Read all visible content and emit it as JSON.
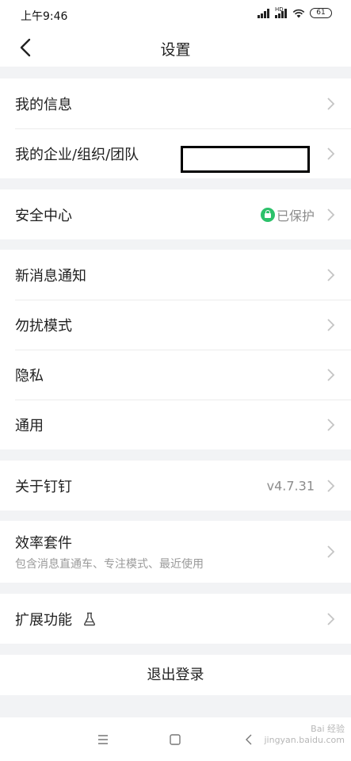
{
  "status_bar": {
    "time": "上午9:46",
    "battery": "61"
  },
  "nav": {
    "title": "设置"
  },
  "groups": {
    "account": {
      "my_info": "我的信息",
      "my_org": "我的企业/组织/团队"
    },
    "security": {
      "label": "安全中心",
      "status": "已保护"
    },
    "prefs": {
      "notify": "新消息通知",
      "dnd": "勿扰模式",
      "privacy": "隐私",
      "general": "通用"
    },
    "about": {
      "label": "关于钉钉",
      "version": "v4.7.31"
    },
    "suite": {
      "label": "效率套件",
      "sub": "包含消息直通车、专注模式、最近使用"
    },
    "extend": {
      "label": "扩展功能"
    }
  },
  "logout": {
    "label": "退出登录"
  },
  "watermark": {
    "line1": "Bai 经验",
    "line2": "jingyan.baidu.com"
  },
  "colors": {
    "accent_green": "#2cc16a",
    "background": "#f2f3f5",
    "text": "#1f1f1f",
    "muted": "#8c8c8c"
  }
}
